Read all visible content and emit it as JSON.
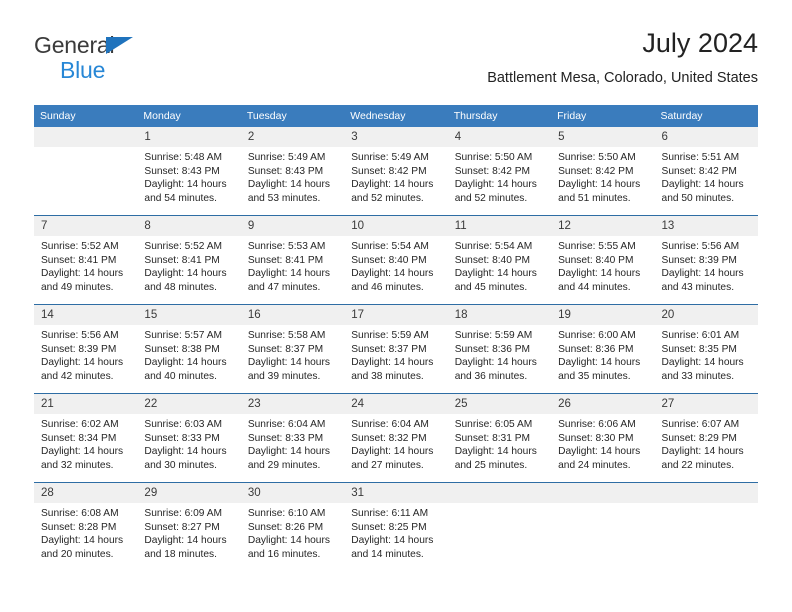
{
  "brand": {
    "name_top": "General",
    "name_bottom": "Blue",
    "triangle_color": "#1f73bd",
    "blue_text_color": "#2787d6"
  },
  "header": {
    "title": "July 2024",
    "subtitle": "Battlement Mesa, Colorado, United States"
  },
  "theme": {
    "header_blue": "#3a7cbd",
    "row_divider_blue": "#2e6da4",
    "daynum_band": "#f0f0f0",
    "text": "#262626"
  },
  "calendar": {
    "weekday_headers": [
      "Sunday",
      "Monday",
      "Tuesday",
      "Wednesday",
      "Thursday",
      "Friday",
      "Saturday"
    ],
    "labels": {
      "sunrise": "Sunrise:",
      "sunset": "Sunset:",
      "daylight": "Daylight:"
    },
    "weeks": [
      [
        {
          "day": "",
          "sunrise": "",
          "sunset": "",
          "daylight": "",
          "empty": true
        },
        {
          "day": "1",
          "sunrise": "Sunrise: 5:48 AM",
          "sunset": "Sunset: 8:43 PM",
          "daylight": "Daylight: 14 hours and 54 minutes."
        },
        {
          "day": "2",
          "sunrise": "Sunrise: 5:49 AM",
          "sunset": "Sunset: 8:43 PM",
          "daylight": "Daylight: 14 hours and 53 minutes."
        },
        {
          "day": "3",
          "sunrise": "Sunrise: 5:49 AM",
          "sunset": "Sunset: 8:42 PM",
          "daylight": "Daylight: 14 hours and 52 minutes."
        },
        {
          "day": "4",
          "sunrise": "Sunrise: 5:50 AM",
          "sunset": "Sunset: 8:42 PM",
          "daylight": "Daylight: 14 hours and 52 minutes."
        },
        {
          "day": "5",
          "sunrise": "Sunrise: 5:50 AM",
          "sunset": "Sunset: 8:42 PM",
          "daylight": "Daylight: 14 hours and 51 minutes."
        },
        {
          "day": "6",
          "sunrise": "Sunrise: 5:51 AM",
          "sunset": "Sunset: 8:42 PM",
          "daylight": "Daylight: 14 hours and 50 minutes."
        }
      ],
      [
        {
          "day": "7",
          "sunrise": "Sunrise: 5:52 AM",
          "sunset": "Sunset: 8:41 PM",
          "daylight": "Daylight: 14 hours and 49 minutes."
        },
        {
          "day": "8",
          "sunrise": "Sunrise: 5:52 AM",
          "sunset": "Sunset: 8:41 PM",
          "daylight": "Daylight: 14 hours and 48 minutes."
        },
        {
          "day": "9",
          "sunrise": "Sunrise: 5:53 AM",
          "sunset": "Sunset: 8:41 PM",
          "daylight": "Daylight: 14 hours and 47 minutes."
        },
        {
          "day": "10",
          "sunrise": "Sunrise: 5:54 AM",
          "sunset": "Sunset: 8:40 PM",
          "daylight": "Daylight: 14 hours and 46 minutes."
        },
        {
          "day": "11",
          "sunrise": "Sunrise: 5:54 AM",
          "sunset": "Sunset: 8:40 PM",
          "daylight": "Daylight: 14 hours and 45 minutes."
        },
        {
          "day": "12",
          "sunrise": "Sunrise: 5:55 AM",
          "sunset": "Sunset: 8:40 PM",
          "daylight": "Daylight: 14 hours and 44 minutes."
        },
        {
          "day": "13",
          "sunrise": "Sunrise: 5:56 AM",
          "sunset": "Sunset: 8:39 PM",
          "daylight": "Daylight: 14 hours and 43 minutes."
        }
      ],
      [
        {
          "day": "14",
          "sunrise": "Sunrise: 5:56 AM",
          "sunset": "Sunset: 8:39 PM",
          "daylight": "Daylight: 14 hours and 42 minutes."
        },
        {
          "day": "15",
          "sunrise": "Sunrise: 5:57 AM",
          "sunset": "Sunset: 8:38 PM",
          "daylight": "Daylight: 14 hours and 40 minutes."
        },
        {
          "day": "16",
          "sunrise": "Sunrise: 5:58 AM",
          "sunset": "Sunset: 8:37 PM",
          "daylight": "Daylight: 14 hours and 39 minutes."
        },
        {
          "day": "17",
          "sunrise": "Sunrise: 5:59 AM",
          "sunset": "Sunset: 8:37 PM",
          "daylight": "Daylight: 14 hours and 38 minutes."
        },
        {
          "day": "18",
          "sunrise": "Sunrise: 5:59 AM",
          "sunset": "Sunset: 8:36 PM",
          "daylight": "Daylight: 14 hours and 36 minutes."
        },
        {
          "day": "19",
          "sunrise": "Sunrise: 6:00 AM",
          "sunset": "Sunset: 8:36 PM",
          "daylight": "Daylight: 14 hours and 35 minutes."
        },
        {
          "day": "20",
          "sunrise": "Sunrise: 6:01 AM",
          "sunset": "Sunset: 8:35 PM",
          "daylight": "Daylight: 14 hours and 33 minutes."
        }
      ],
      [
        {
          "day": "21",
          "sunrise": "Sunrise: 6:02 AM",
          "sunset": "Sunset: 8:34 PM",
          "daylight": "Daylight: 14 hours and 32 minutes."
        },
        {
          "day": "22",
          "sunrise": "Sunrise: 6:03 AM",
          "sunset": "Sunset: 8:33 PM",
          "daylight": "Daylight: 14 hours and 30 minutes."
        },
        {
          "day": "23",
          "sunrise": "Sunrise: 6:04 AM",
          "sunset": "Sunset: 8:33 PM",
          "daylight": "Daylight: 14 hours and 29 minutes."
        },
        {
          "day": "24",
          "sunrise": "Sunrise: 6:04 AM",
          "sunset": "Sunset: 8:32 PM",
          "daylight": "Daylight: 14 hours and 27 minutes."
        },
        {
          "day": "25",
          "sunrise": "Sunrise: 6:05 AM",
          "sunset": "Sunset: 8:31 PM",
          "daylight": "Daylight: 14 hours and 25 minutes."
        },
        {
          "day": "26",
          "sunrise": "Sunrise: 6:06 AM",
          "sunset": "Sunset: 8:30 PM",
          "daylight": "Daylight: 14 hours and 24 minutes."
        },
        {
          "day": "27",
          "sunrise": "Sunrise: 6:07 AM",
          "sunset": "Sunset: 8:29 PM",
          "daylight": "Daylight: 14 hours and 22 minutes."
        }
      ],
      [
        {
          "day": "28",
          "sunrise": "Sunrise: 6:08 AM",
          "sunset": "Sunset: 8:28 PM",
          "daylight": "Daylight: 14 hours and 20 minutes."
        },
        {
          "day": "29",
          "sunrise": "Sunrise: 6:09 AM",
          "sunset": "Sunset: 8:27 PM",
          "daylight": "Daylight: 14 hours and 18 minutes."
        },
        {
          "day": "30",
          "sunrise": "Sunrise: 6:10 AM",
          "sunset": "Sunset: 8:26 PM",
          "daylight": "Daylight: 14 hours and 16 minutes."
        },
        {
          "day": "31",
          "sunrise": "Sunrise: 6:11 AM",
          "sunset": "Sunset: 8:25 PM",
          "daylight": "Daylight: 14 hours and 14 minutes."
        },
        {
          "day": "",
          "sunrise": "",
          "sunset": "",
          "daylight": "",
          "empty": true
        },
        {
          "day": "",
          "sunrise": "",
          "sunset": "",
          "daylight": "",
          "empty": true
        },
        {
          "day": "",
          "sunrise": "",
          "sunset": "",
          "daylight": "",
          "empty": true
        }
      ]
    ]
  }
}
